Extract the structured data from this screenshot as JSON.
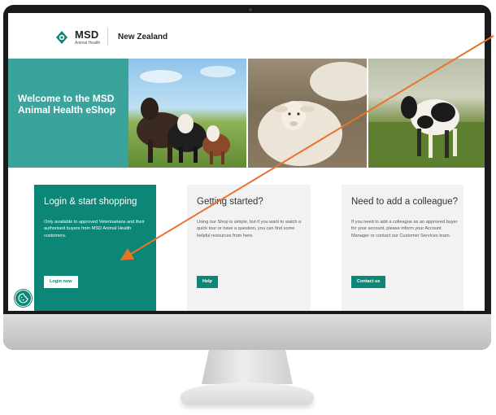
{
  "header": {
    "logo_brand": "MSD",
    "logo_sub": "Animal Health",
    "region": "New Zealand"
  },
  "hero": {
    "welcome_title": "Welcome to the MSD Animal Health eShop"
  },
  "cards": {
    "login": {
      "title": "Login & start shopping",
      "body": "Only available to approved Veterinarians and their authorised buyers from MSD Animal Health customers.",
      "button": "Login now"
    },
    "getting_started": {
      "title": "Getting started?",
      "body": "Using our Shop is simple, but if you want to watch a quick tour or have a question, you can find some helpful resources from here.",
      "button": "Help"
    },
    "colleague": {
      "title": "Need to add a colleague?",
      "body": "If you need to add a colleague as an approved buyer for your account, please inform your Account Manager or contact our Customer Services team.",
      "button": "Contact us"
    }
  },
  "icons": {
    "logo": "msd-logo-icon",
    "cookie": "cookie-icon"
  },
  "colors": {
    "brand_teal": "#0c8777",
    "hero_teal": "#3aa39b",
    "card_grey": "#f2f2f2",
    "annotation_arrow": "#e8742a"
  }
}
